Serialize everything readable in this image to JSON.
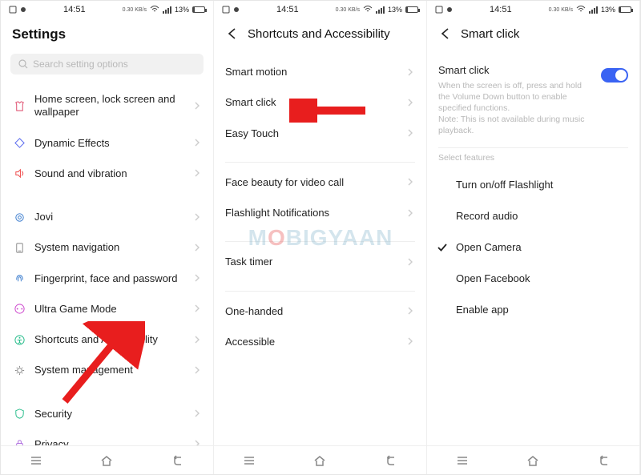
{
  "status": {
    "time": "14:51",
    "battery_pct": "13%",
    "network_label": "0.30 KB/s"
  },
  "panel1": {
    "title": "Settings",
    "search_placeholder": "Search setting options",
    "items": [
      {
        "label": "Home screen, lock screen and wallpaper",
        "icon": "shirt"
      },
      {
        "label": "Dynamic Effects",
        "icon": "diamond"
      },
      {
        "label": "Sound and vibration",
        "icon": "speaker"
      },
      {
        "label": "Jovi",
        "icon": "ring"
      },
      {
        "label": "System navigation",
        "icon": "phone-rect"
      },
      {
        "label": "Fingerprint, face and password",
        "icon": "fingerprint"
      },
      {
        "label": "Ultra Game Mode",
        "icon": "gamepad"
      },
      {
        "label": "Shortcuts and Accessibility",
        "icon": "accessibility"
      },
      {
        "label": "System management",
        "icon": "gear"
      },
      {
        "label": "Security",
        "icon": "shield"
      },
      {
        "label": "Privacy",
        "icon": "lock"
      }
    ]
  },
  "panel2": {
    "title": "Shortcuts and Accessibility",
    "groups": [
      [
        "Smart motion",
        "Smart click",
        "Easy Touch"
      ],
      [
        "Face beauty for video call",
        "Flashlight Notifications"
      ],
      [
        "Task timer"
      ],
      [
        "One-handed",
        "Accessible"
      ]
    ]
  },
  "panel3": {
    "title": "Smart click",
    "toggle_title": "Smart click",
    "toggle_desc1": "When the screen is off, press and hold the Volume Down button to enable specified functions.",
    "toggle_desc2": "Note: This is not available during music playback.",
    "toggle_on": true,
    "section": "Select features",
    "features": [
      {
        "label": "Turn on/off Flashlight",
        "checked": false
      },
      {
        "label": "Record audio",
        "checked": false
      },
      {
        "label": "Open Camera",
        "checked": true
      },
      {
        "label": "Open Facebook",
        "checked": false
      },
      {
        "label": "Enable app",
        "checked": false,
        "chevron": true
      }
    ]
  },
  "nav_labels": [
    "recents",
    "home",
    "back"
  ],
  "watermark": "MOBIGYAAN"
}
